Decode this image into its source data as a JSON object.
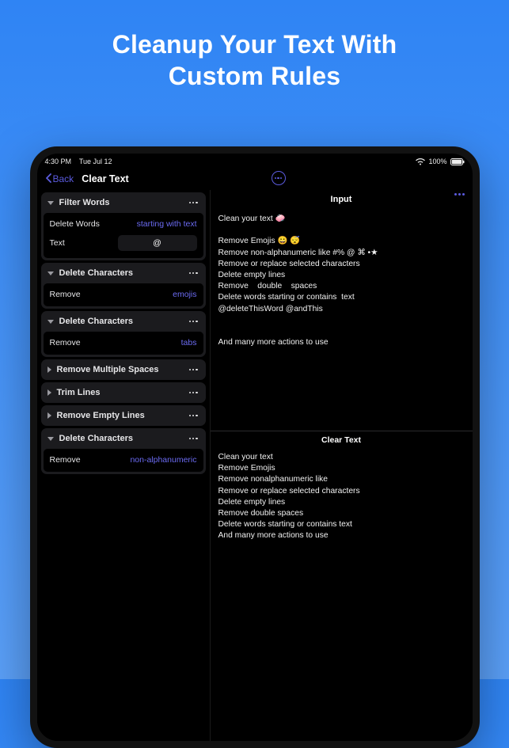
{
  "promo": {
    "line1": "Cleanup Your Text With",
    "line2": "Custom Rules"
  },
  "status": {
    "time": "4:30 PM",
    "date": "Tue Jul 12",
    "network_label": "100%",
    "wifi_icon": "wifi-icon",
    "battery_icon": "battery-full-icon"
  },
  "nav": {
    "back_label": "Back",
    "title": "Clear Text"
  },
  "sidebar": {
    "rules": [
      {
        "title": "Filter Words",
        "expanded": true,
        "rows": [
          {
            "label": "Delete Words",
            "value": "starting with text",
            "kind": "link"
          },
          {
            "label": "Text",
            "value": "@",
            "kind": "input"
          }
        ]
      },
      {
        "title": "Delete Characters",
        "expanded": true,
        "rows": [
          {
            "label": "Remove",
            "value": "emojis",
            "kind": "link"
          }
        ]
      },
      {
        "title": "Delete Characters",
        "expanded": true,
        "rows": [
          {
            "label": "Remove",
            "value": "tabs",
            "kind": "link"
          }
        ]
      },
      {
        "title": "Remove Multiple Spaces",
        "expanded": false,
        "rows": []
      },
      {
        "title": "Trim Lines",
        "expanded": false,
        "rows": []
      },
      {
        "title": "Remove Empty Lines",
        "expanded": false,
        "rows": []
      },
      {
        "title": "Delete Characters",
        "expanded": true,
        "rows": [
          {
            "label": "Remove",
            "value": "non-alphanumeric",
            "kind": "link"
          }
        ]
      }
    ]
  },
  "main": {
    "input_title": "Input",
    "input_text": "Clean your text 🧼\n\nRemove Emojis 😀 😴\nRemove non-alphanumeric like #% @ ⌘ •★\nRemove or replace selected characters\nDelete empty lines\nRemove    double    spaces\nDelete words starting or contains  text\n@deleteThisWord @andThis\n\n\nAnd many more actions to use",
    "output_title": "Clear Text",
    "output_text": "Clean your text\nRemove Emojis\nRemove nonalphanumeric like\nRemove or replace selected characters\nDelete empty lines\nRemove double spaces\nDelete words starting or contains text\nAnd many more actions to use"
  }
}
